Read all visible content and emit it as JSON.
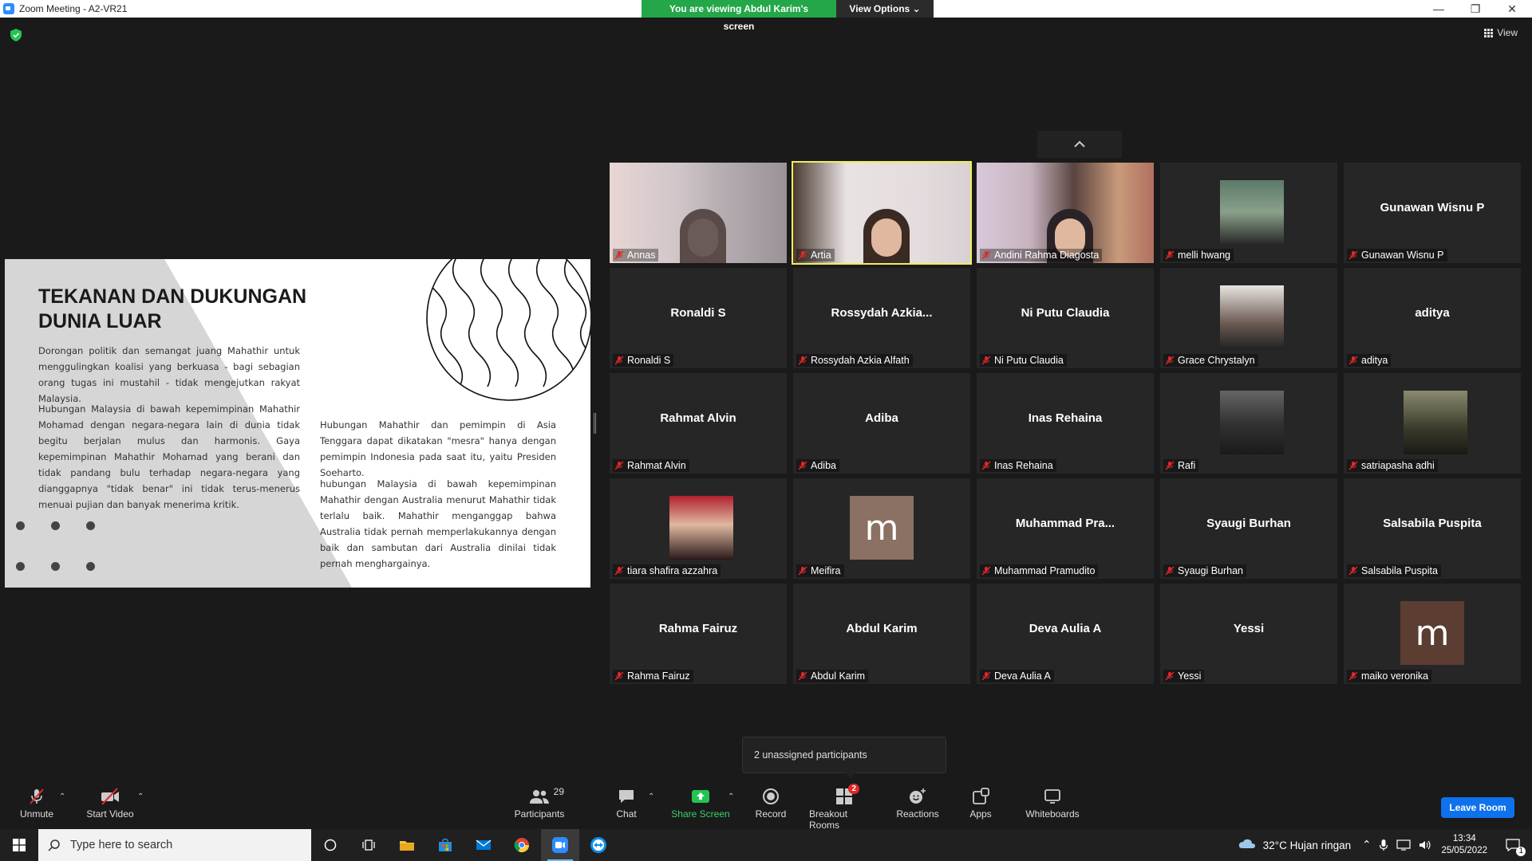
{
  "window": {
    "title": "Zoom Meeting - A2-VR21"
  },
  "banner": {
    "message": "You are viewing Abdul Karim's screen",
    "view_options": "View Options"
  },
  "view_label": "View",
  "slide": {
    "title_line1": "TEKANAN DAN DUKUNGAN",
    "title_line2": "DUNIA LUAR",
    "para1": "Dorongan politik dan semangat juang Mahathir untuk menggulingkan koalisi yang berkuasa - bagi sebagian orang tugas ini mustahil - tidak mengejutkan rakyat Malaysia.",
    "para2": "Hubungan Malaysia di bawah kepemimpinan Mahathir Mohamad dengan negara-negara lain di dunia tidak begitu berjalan mulus dan harmonis. Gaya kepemimpinan Mahathir Mohamad yang berani dan tidak pandang bulu terhadap negara-negara yang dianggapnya \"tidak benar\" ini tidak terus-menerus menuai pujian dan banyak menerima kritik.",
    "para3": "Hubungan Mahathir dan pemimpin di Asia Tenggara dapat dikatakan \"mesra\" hanya dengan pemimpin Indonesia pada saat itu, yaitu Presiden Soeharto.",
    "para4": "hubungan Malaysia di bawah kepemimpinan Mahathir dengan Australia menurut Mahathir tidak terlalu baik. Mahathir menganggap bahwa Australia tidak pernah memperlakukannya dengan baik dan sambutan dari Australia dinilai tidak pernah menghargainya."
  },
  "participants_grid": [
    {
      "label": "Annas",
      "center": "",
      "kind": "video"
    },
    {
      "label": "Artia",
      "center": "",
      "kind": "video"
    },
    {
      "label": "Andini Rahma Diagosta",
      "center": "",
      "kind": "video"
    },
    {
      "label": "melli hwang",
      "center": "",
      "kind": "photo"
    },
    {
      "label": "Gunawan Wisnu P",
      "center": "Gunawan Wisnu P",
      "kind": "name"
    },
    {
      "label": "Ronaldi S",
      "center": "Ronaldi S",
      "kind": "name"
    },
    {
      "label": "Rossydah Azkia Alfath",
      "center": "Rossydah  Azkia...",
      "kind": "name"
    },
    {
      "label": "Ni Putu Claudia",
      "center": "Ni Putu Claudia",
      "kind": "name"
    },
    {
      "label": "Grace Chrystalyn",
      "center": "",
      "kind": "photo"
    },
    {
      "label": "aditya",
      "center": "aditya",
      "kind": "name"
    },
    {
      "label": "Rahmat Alvin",
      "center": "Rahmat Alvin",
      "kind": "name"
    },
    {
      "label": "Adiba",
      "center": "Adiba",
      "kind": "name"
    },
    {
      "label": "Inas Rehaina",
      "center": "Inas Rehaina",
      "kind": "name"
    },
    {
      "label": "Rafi",
      "center": "",
      "kind": "photo"
    },
    {
      "label": "satriapasha adhi",
      "center": "",
      "kind": "photo"
    },
    {
      "label": "tiara shafira azzahra",
      "center": "",
      "kind": "photo"
    },
    {
      "label": "Meifira",
      "center": "m",
      "kind": "avatar"
    },
    {
      "label": "Muhammad Pramudito",
      "center": "Muhammad  Pra...",
      "kind": "name"
    },
    {
      "label": "Syaugi Burhan",
      "center": "Syaugi Burhan",
      "kind": "name"
    },
    {
      "label": "Salsabila Puspita",
      "center": "Salsabila Puspita",
      "kind": "name"
    },
    {
      "label": "Rahma Fairuz",
      "center": "Rahma Fairuz",
      "kind": "name"
    },
    {
      "label": "Abdul Karim",
      "center": "Abdul Karim",
      "kind": "name"
    },
    {
      "label": "Deva Aulia A",
      "center": "Deva Aulia A",
      "kind": "name"
    },
    {
      "label": "Yessi",
      "center": "Yessi",
      "kind": "name"
    },
    {
      "label": "maiko veronika",
      "center": "m",
      "kind": "avatar"
    }
  ],
  "tooltip": "2 unassigned participants",
  "toolbar": {
    "unmute": "Unmute",
    "start_video": "Start Video",
    "participants": "Participants",
    "participants_count": "29",
    "chat": "Chat",
    "share_screen": "Share Screen",
    "record": "Record",
    "breakout_rooms": "Breakout Rooms",
    "breakout_badge": "2",
    "reactions": "Reactions",
    "apps": "Apps",
    "whiteboards": "Whiteboards",
    "leave": "Leave Room"
  },
  "taskbar": {
    "search_placeholder": "Type here to search",
    "weather": "32°C  Hujan ringan",
    "time": "13:34",
    "date": "25/05/2022",
    "notif_count": "1"
  },
  "colors": {
    "accent_green": "#23a749",
    "active_speaker": "#f0ee5e",
    "leave_blue": "#0e72ed",
    "avatar_meifira": "#8a7163",
    "avatar_maiko": "#5c3d32"
  }
}
